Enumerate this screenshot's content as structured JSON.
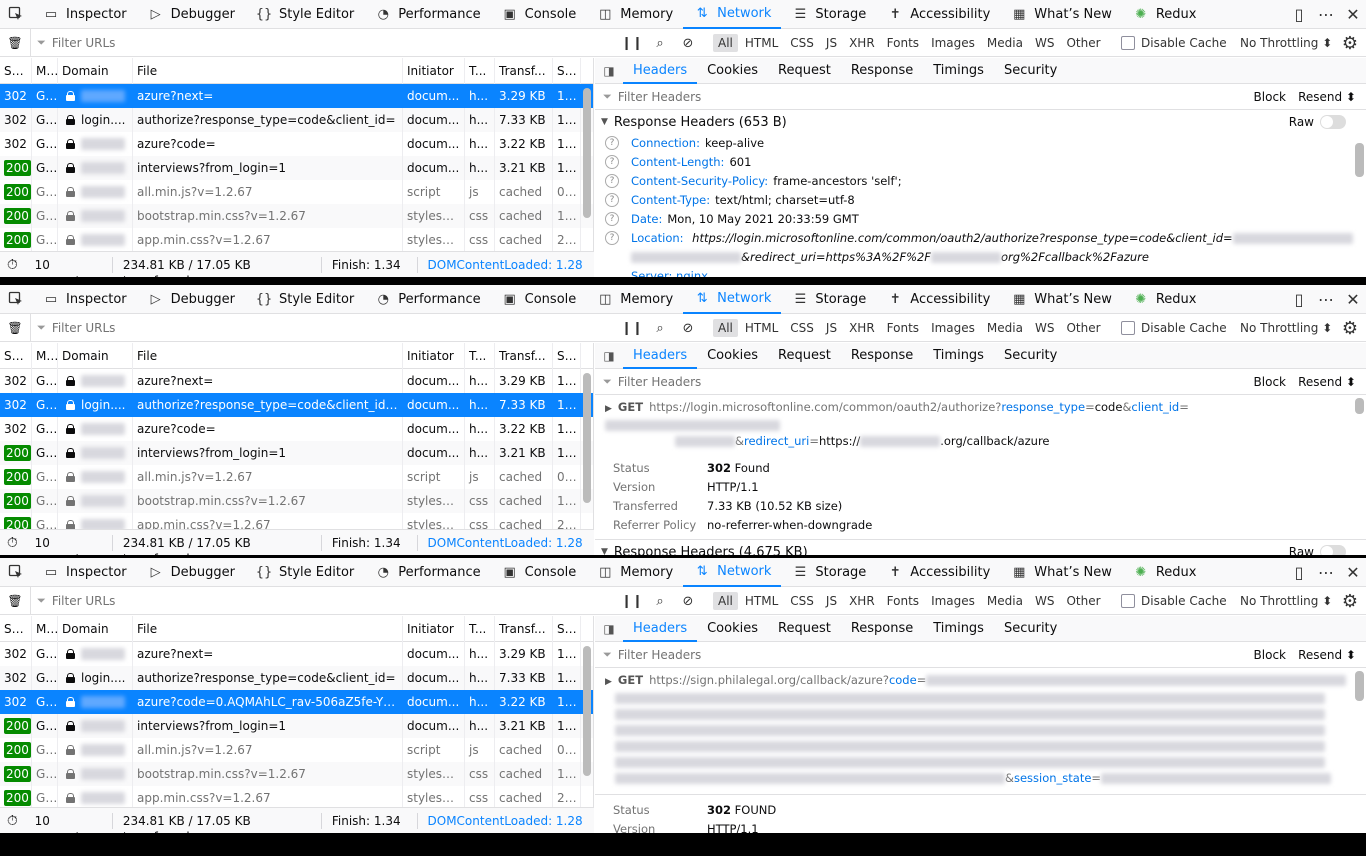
{
  "toolbar": {
    "tabs": [
      {
        "label": "Inspector",
        "icon": "inspector-icon"
      },
      {
        "label": "Debugger",
        "icon": "debugger-icon"
      },
      {
        "label": "Style Editor",
        "icon": "style-editor-icon"
      },
      {
        "label": "Performance",
        "icon": "performance-icon"
      },
      {
        "label": "Console",
        "icon": "console-icon"
      },
      {
        "label": "Memory",
        "icon": "memory-icon"
      },
      {
        "label": "Network",
        "icon": "network-icon"
      },
      {
        "label": "Storage",
        "icon": "storage-icon"
      },
      {
        "label": "Accessibility",
        "icon": "accessibility-icon"
      },
      {
        "label": "What’s New",
        "icon": "whats-new-icon"
      },
      {
        "label": "Redux",
        "icon": "redux-icon"
      }
    ],
    "selected_tab": "Network"
  },
  "filterbar": {
    "filter_placeholder": "Filter URLs",
    "types": [
      "All",
      "HTML",
      "CSS",
      "JS",
      "XHR",
      "Fonts",
      "Images",
      "Media",
      "WS",
      "Other"
    ],
    "active_type": "All",
    "disable_cache_label": "Disable Cache",
    "throttle_label": "No Throttling ⬍"
  },
  "columns": {
    "status": "St...",
    "method": "Me",
    "domain": "Domain",
    "file": "File",
    "initiator": "Initiator",
    "type": "T...",
    "transferred": "Transf...",
    "size": "S..."
  },
  "requests": [
    {
      "status": "302",
      "method": "GET",
      "domain": "",
      "file": "azure?next=",
      "initiator": "docum...",
      "type": "h...",
      "transferred": "3.29 KB",
      "size": "1..."
    },
    {
      "status": "302",
      "method": "GET",
      "domain": "login....",
      "file": "authorize?response_type=code&client_id=",
      "initiator": "docum...",
      "type": "h...",
      "transferred": "7.33 KB",
      "size": "1..."
    },
    {
      "status": "302",
      "method": "GET",
      "domain": "",
      "file": "azure?code=",
      "initiator": "docum...",
      "type": "h...",
      "transferred": "3.22 KB",
      "size": "1..."
    },
    {
      "status": "200",
      "method": "GET",
      "domain": "",
      "file": "interviews?from_login=1",
      "initiator": "docum...",
      "type": "h...",
      "transferred": "3.21 KB",
      "size": "1..."
    },
    {
      "status": "200",
      "method": "GET",
      "domain": "",
      "file": "all.min.js?v=1.2.67",
      "initiator": "script",
      "type": "js",
      "transferred": "cached",
      "size": "0 B"
    },
    {
      "status": "200",
      "method": "GET",
      "domain": "",
      "file": "bootstrap.min.css?v=1.2.67",
      "initiator": "stylesh...",
      "type": "css",
      "transferred": "cached",
      "size": "1..."
    },
    {
      "status": "200",
      "method": "GET",
      "domain": "",
      "file": "app.min.css?v=1.2.67",
      "initiator": "stylesh...",
      "type": "css",
      "transferred": "cached",
      "size": "2..."
    }
  ],
  "panel2_row2_file": "authorize?response_type=code&client_id=3...",
  "panel3_row3_file": "azure?code=0.AQMAhLC_rav-506aZ5fe-Yhm...",
  "summary": {
    "requests": "10 requests",
    "size": "234.81 KB / 17.05 KB transferred",
    "finish": "Finish: 1.34 s",
    "domcontent": "DOMContentLoaded: 1.28 s"
  },
  "details": {
    "tabs": [
      "Headers",
      "Cookies",
      "Request",
      "Response",
      "Timings",
      "Security"
    ],
    "selected_tab": "Headers",
    "filter_placeholder": "Filter Headers",
    "block_label": "Block",
    "resend_label": "Resend ⬍",
    "raw_label": "Raw"
  },
  "panel1": {
    "response_headers_title": "Response Headers (653 B)",
    "headers": [
      {
        "name": "Connection:",
        "value": "keep-alive"
      },
      {
        "name": "Content-Length:",
        "value": "601"
      },
      {
        "name": "Content-Security-Policy:",
        "value": "frame-ancestors 'self';"
      },
      {
        "name": "Content-Type:",
        "value": "text/html; charset=utf-8"
      },
      {
        "name": "Date:",
        "value": "Mon, 10 May 2021 20:33:59 GMT"
      }
    ],
    "location_name": "Location:",
    "location_value_1": "https://login.microsoftonline.com/common/oauth2/authorize?response_type=code&client_id=",
    "location_value_2a": "&redirect_uri=https%3A%2F%2F",
    "location_value_2b": "org%2Fcallback%2Fazure",
    "server_partial": "Server: nginx"
  },
  "panel2": {
    "method": "GET",
    "url_host": "https://login.microsoftonline.com/common/oauth2/authorize",
    "q": "?",
    "p1": "response_type",
    "v1": "code",
    "p2": "client_id",
    "p3": "redirect_uri",
    "v3a": "https://",
    "v3b": ".org/callback/azure",
    "status_k": "Status",
    "status_code": "302",
    "status_text": "Found",
    "version_k": "Version",
    "version_v": "HTTP/1.1",
    "transferred_k": "Transferred",
    "transferred_v": "7.33 KB (10.52 KB size)",
    "referrer_k": "Referrer Policy",
    "referrer_v": "no-referrer-when-downgrade",
    "response_headers_title": "Response Headers (4.675 KB)"
  },
  "panel3": {
    "method": "GET",
    "url_host": "https://sign.philalegal.org/callback/azure",
    "q": "?",
    "p1": "code",
    "p2": "session_state",
    "status_k": "Status",
    "status_code": "302",
    "status_text": "FOUND",
    "version_k": "Version",
    "version_v": "HTTP/1.1"
  },
  "colors": {
    "accent": "#0a84ff",
    "status_ok": "#058b00",
    "header_name": "#0074e8"
  }
}
